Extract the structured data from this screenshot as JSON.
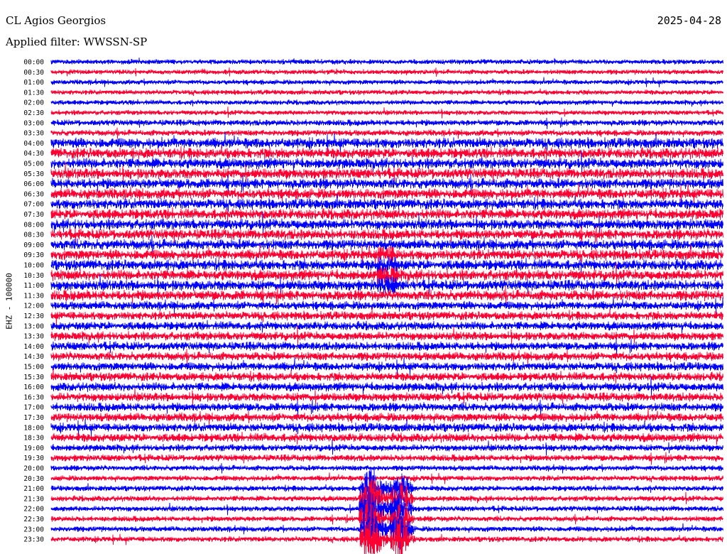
{
  "header": {
    "station": "CL Agios Georgios",
    "date": "2025-04-28",
    "filter": "Applied filter: WWSSN-SP"
  },
  "colors": {
    "even_row": "#0000ff",
    "odd_row": "#ff0033",
    "background": "#ffffff"
  },
  "chart_data": {
    "type": "line",
    "ylabel": "EHZ - 100000",
    "rows": [
      "00:00",
      "00:30",
      "01:00",
      "01:30",
      "02:00",
      "02:30",
      "03:00",
      "03:30",
      "04:00",
      "04:30",
      "05:00",
      "05:30",
      "06:00",
      "06:30",
      "07:00",
      "07:30",
      "08:00",
      "08:30",
      "09:00",
      "09:30",
      "10:00",
      "10:30",
      "11:00",
      "11:30",
      "12:00",
      "12:30",
      "13:00",
      "13:30",
      "14:00",
      "14:30",
      "15:00",
      "15:30",
      "16:00",
      "16:30",
      "17:00",
      "17:30",
      "18:00",
      "18:30",
      "19:00",
      "19:30",
      "20:00",
      "20:30",
      "21:00",
      "21:30",
      "22:00",
      "22:30",
      "23:00",
      "23:30"
    ],
    "grid": false,
    "legend": "none"
  }
}
